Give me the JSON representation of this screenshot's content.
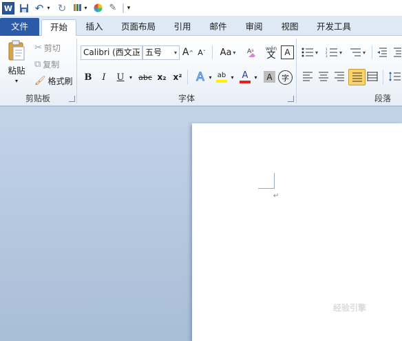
{
  "qat": {
    "app_icon": "word-icon",
    "app_letter": "W",
    "buttons": [
      {
        "name": "save-icon",
        "glyph": "💾"
      },
      {
        "name": "undo-icon",
        "glyph": "↶"
      },
      {
        "name": "redo-icon",
        "glyph": "↻"
      },
      {
        "name": "format-painter-qat-icon",
        "glyph": "🖌"
      },
      {
        "name": "color-wheel-icon",
        "glyph": "◕"
      },
      {
        "name": "eraser-icon",
        "glyph": "✎"
      },
      {
        "name": "customize-qat-icon",
        "glyph": "▾"
      }
    ]
  },
  "tabs": {
    "file": "文件",
    "items": [
      "开始",
      "插入",
      "页面布局",
      "引用",
      "邮件",
      "审阅",
      "视图",
      "开发工具"
    ],
    "active_index": 0
  },
  "clipboard": {
    "label": "剪贴板",
    "paste": "粘贴",
    "cut": "剪切",
    "copy": "复制",
    "format_painter": "格式刷"
  },
  "font": {
    "label": "字体",
    "font_name": "Calibri (西文正",
    "font_size": "五号",
    "grow_font": "A",
    "shrink_font": "A",
    "change_case": "Aa",
    "clear_format": "A",
    "pinyin": "wén",
    "pinyin_char": "文",
    "char_border": "A",
    "bold": "B",
    "italic": "I",
    "underline": "U",
    "strikethrough": "abc",
    "subscript": "x₂",
    "superscript": "x²",
    "text_effects": "A",
    "highlight": "ab",
    "font_color": "A",
    "char_shading": "A",
    "enclose_char": "字"
  },
  "paragraph": {
    "label": "段落"
  },
  "document": {
    "paragraph_mark": "↵",
    "watermark_text": "经验引擎"
  },
  "colors": {
    "file_tab": "#2a5aa8",
    "highlight_yellow": "#ffef00",
    "font_red": "#e81f1f",
    "active_align": "#fbd36a"
  }
}
